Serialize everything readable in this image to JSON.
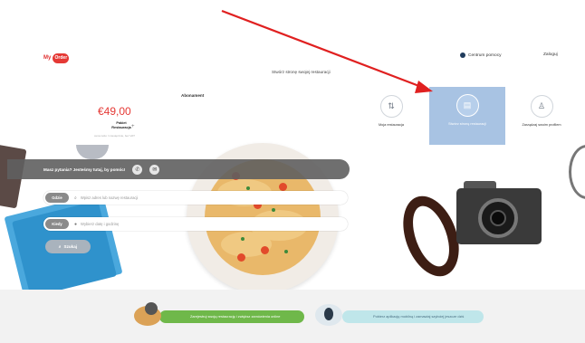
{
  "brand": {
    "logo_text": "My",
    "logo_badge": "Order"
  },
  "header": {
    "help_label": "Centrum pomocy",
    "login_label": "Zaloguj",
    "tagline": "Stwórz stronę swojej restauracji"
  },
  "pricing": {
    "title": "Abonament",
    "price": "€49,00",
    "price_sub": "Pakiet Restauracja",
    "plus_symbol": "+",
    "note": "cena netto / miesięcznie, bez VAT"
  },
  "services": [
    {
      "label": "Moja restauracja",
      "icon": "swap-icon",
      "active": false
    },
    {
      "label": "Stwórz stronę restauracji",
      "icon": "storefront-icon",
      "active": true
    },
    {
      "label": "Zarządzaj swoim profilem",
      "icon": "user-icon",
      "active": false
    }
  ],
  "form": {
    "banner_text": "Masz pytania? Jesteśmy tutaj, by pomóc!",
    "field1": {
      "tag": "Gdzie",
      "placeholder": "Wpisz adres lub nazwę restauracji"
    },
    "field2": {
      "tag": "Kiedy",
      "placeholder": "Wybierz datę i godzinę"
    },
    "submit_label": "Szukaj"
  },
  "footer": {
    "promo1": "Zarejestruj swoją restaurację i zwiększ zamówienia online",
    "promo2": "Pobierz aplikację mobilną i zamawiaj szybciej jeszcze dziś"
  },
  "colors": {
    "accent_red": "#e53935",
    "active_tile": "#a8c3e3",
    "annotation_arrow": "#e02020",
    "promo_green": "#6fb84a",
    "promo_teal": "#bfe6ea"
  }
}
